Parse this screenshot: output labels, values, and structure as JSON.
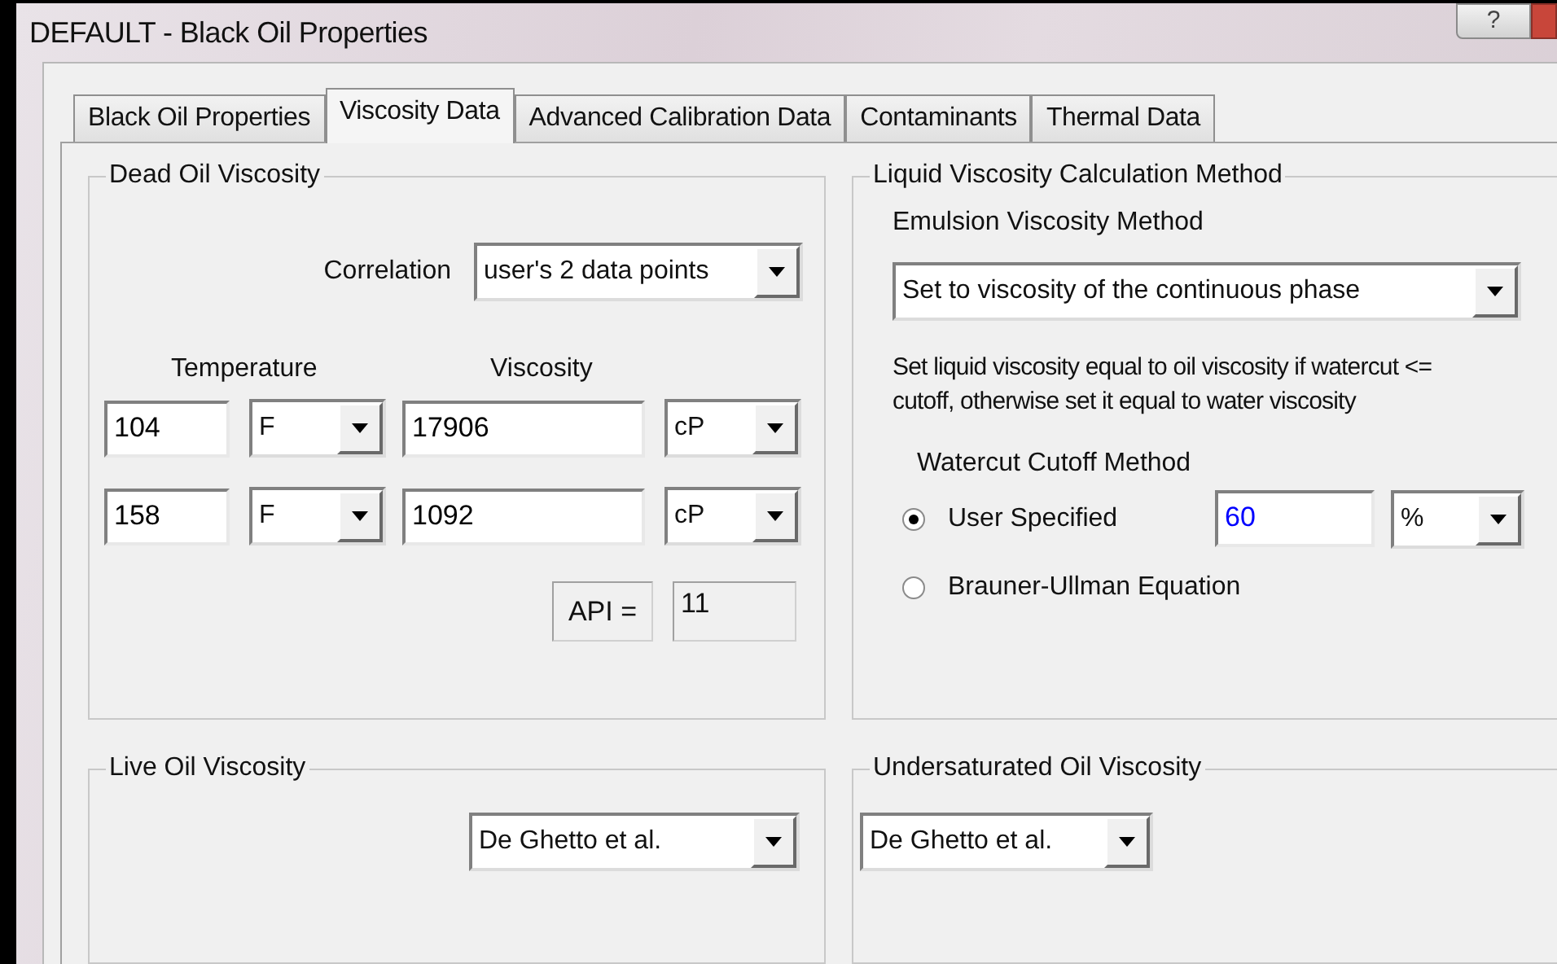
{
  "window": {
    "title": "DEFAULT - Black Oil Properties",
    "help_button": "?"
  },
  "tabs": [
    {
      "label": "Black Oil Properties",
      "selected": false
    },
    {
      "label": "Viscosity Data",
      "selected": true
    },
    {
      "label": "Advanced Calibration Data",
      "selected": false
    },
    {
      "label": "Contaminants",
      "selected": false
    },
    {
      "label": "Thermal Data",
      "selected": false
    }
  ],
  "dead_oil_viscosity": {
    "title": "Dead Oil Viscosity",
    "correlation_label": "Correlation",
    "correlation_value": "user's 2 data points",
    "temperature_header": "Temperature",
    "viscosity_header": "Viscosity",
    "rows": [
      {
        "temperature": "104",
        "temperature_unit": "F",
        "viscosity": "17906",
        "viscosity_unit": "cP"
      },
      {
        "temperature": "158",
        "temperature_unit": "F",
        "viscosity": "1092",
        "viscosity_unit": "cP"
      }
    ],
    "api_label": "API =",
    "api_value": "11"
  },
  "liquid_viscosity_calculation_method": {
    "title": "Liquid Viscosity Calculation Method",
    "emulsion_label": "Emulsion Viscosity Method",
    "emulsion_value": "Set to viscosity of the continuous phase",
    "description": "Set liquid viscosity equal to oil viscosity if watercut <= cutoff, otherwise set it equal to water viscosity",
    "watercut_title": "Watercut Cutoff Method",
    "options": [
      {
        "label": "User Specified",
        "selected": true
      },
      {
        "label": "Brauner-Ullman Equation",
        "selected": false
      }
    ],
    "cutoff_value": "60",
    "cutoff_unit": "%"
  },
  "live_oil_viscosity": {
    "title": "Live Oil Viscosity",
    "value": "De Ghetto et al."
  },
  "undersaturated_oil_viscosity": {
    "title": "Undersaturated Oil Viscosity",
    "value": "De Ghetto et al."
  }
}
